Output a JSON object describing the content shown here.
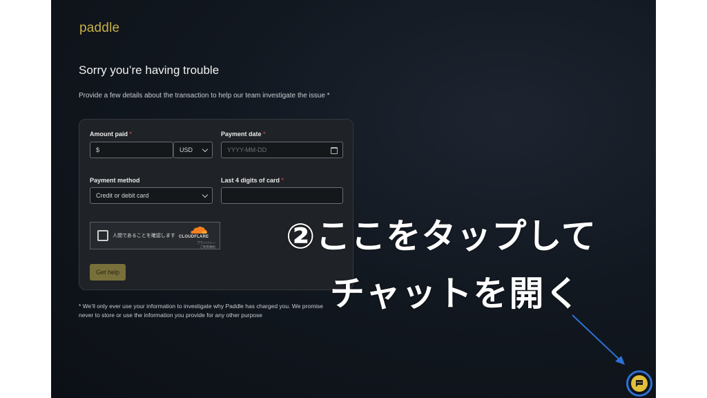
{
  "brand": {
    "logo_text": "paddle"
  },
  "page": {
    "title": "Sorry you’re having trouble",
    "intro": "Provide a few details about the transaction to help our team investigate the issue *",
    "footnote_line1": "* We’ll only ever use your information to investigate why Paddle has charged you. We promise",
    "footnote_line2": "never to store or use the information you provide for any other purpose"
  },
  "form": {
    "amount_label": "Amount paid",
    "amount_prefix": "$",
    "currency_value": "USD",
    "date_label": "Payment date",
    "date_placeholder": "YYYY-MM-DD",
    "method_label": "Payment method",
    "method_value": "Credit or debit card",
    "card_label": "Last 4 digits of card",
    "required_mark": "*",
    "submit_label": "Get help"
  },
  "captcha": {
    "checkbox_text": "人間であることを確認します",
    "provider": "CLOUDFLARE",
    "link_privacy": "プライバシー",
    "link_terms": "ご利用規約"
  },
  "overlay": {
    "line1": "②ここをタップして",
    "line2": "チャットを開く"
  },
  "colors": {
    "accent_gold": "#c7b04a",
    "button_olive": "#77703a",
    "chat_yellow": "#e0bf3a",
    "highlight_blue": "#2d72d6",
    "cloudflare_orange": "#f38020"
  },
  "icons": [
    "calendar-icon",
    "chevron-down-icon",
    "chat-icon",
    "cloudflare-icon",
    "arrow-icon"
  ]
}
